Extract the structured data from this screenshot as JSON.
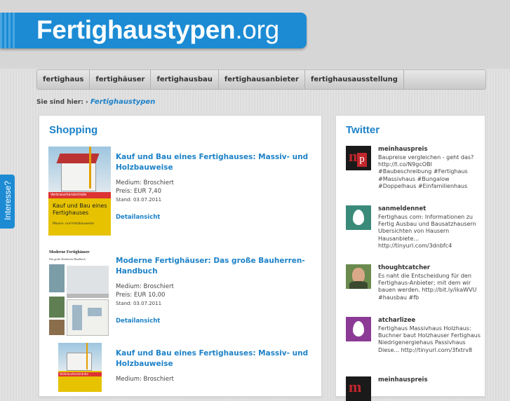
{
  "header": {
    "logo_bold": "Fertighaustypen",
    "logo_tld": ".org"
  },
  "nav": {
    "items": [
      "fertighaus",
      "fertighäuser",
      "fertighausbau",
      "fertighausanbieter",
      "fertighausausstellung"
    ]
  },
  "breadcrumb": {
    "prefix": "Sie sind hier:",
    "separator": "›",
    "current": "Fertighaustypen"
  },
  "side_tab": {
    "label": "Interesse?"
  },
  "shopping": {
    "title": "Shopping",
    "products": [
      {
        "title": "Kauf und Bau eines Fertighauses: Massiv- und Holzbauweise",
        "medium": "Medium: Broschiert",
        "price": "Preis: EUR 7,40",
        "date": "Stand: 03.07.2011",
        "detail": "Detailansicht",
        "cover_text_top": "Verbraucherzentrale",
        "cover_title": "Kauf und Bau eines Fertighauses",
        "cover_sub": "Massiv- und Holzbauweise"
      },
      {
        "title": "Moderne Fertighäuser: Das große Bauherren-Handbuch",
        "medium": "Medium: Broschiert",
        "price": "Preis: EUR 10,00",
        "date": "Stand: 03.07.2011",
        "detail": "Detailansicht",
        "cover_title": "Moderne Fertighäuser",
        "cover_sub": "Das große Bauherren-Handbuch"
      },
      {
        "title": "Kauf und Bau eines Fertighauses: Massiv- und Holzbauweise",
        "medium": "Medium: Broschiert",
        "price": "",
        "date": "",
        "detail": "",
        "cover_text_top": "Verbraucherzentrale",
        "cover_title": "",
        "cover_sub": ""
      }
    ]
  },
  "twitter": {
    "title": "Twitter",
    "tweets": [
      {
        "user": "meinhauspreis",
        "text": "Baupreise vergleichen - geht das? http://t.co/N9gcOBl #Baubeschreibung #Fertighaus #Massivhaus #Bungalow #Doppelhaus #Einfamilienhaus"
      },
      {
        "user": "sanmeldennet",
        "text": "Fertighaus com: Informationen zu Fertig Ausbau und Bausatzhausern Ubersichten von Hausern Hausanbiete... http://tinyurl.com/3dnbfc4"
      },
      {
        "user": "thoughtcatcher",
        "text": "Es naht die Entscheidung für den Fertighaus-Anbieter; mit dem wir bauen werden. http://bit.ly/ikaWVU #hausbau #fb"
      },
      {
        "user": "atcharlizee",
        "text": "Fertighaus Massivhaus Holzhaus: Buchner baut Holzhauser Fertighaus Niedrigenergiehaus Passivhaus Diese... http://tinyurl.com/3fxtrv8"
      },
      {
        "user": "meinhauspreis",
        "text": ""
      }
    ]
  },
  "colors": {
    "accent": "#1c8bd4",
    "link": "#1d82c8"
  }
}
